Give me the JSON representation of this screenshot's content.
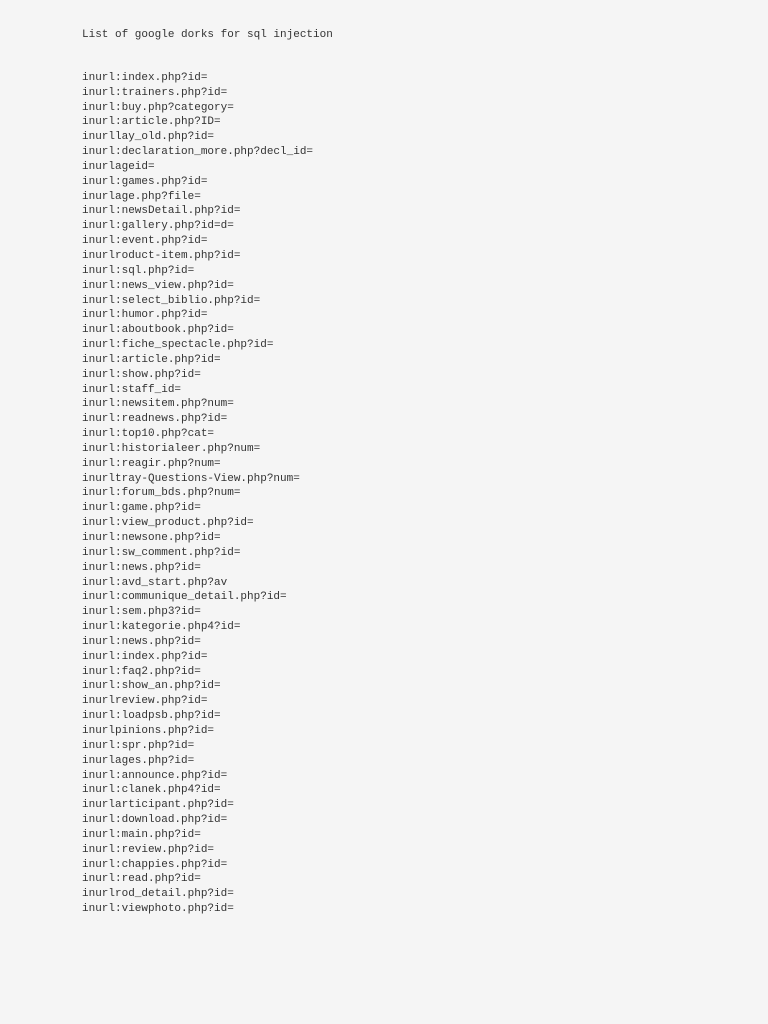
{
  "title": "List of google dorks for sql injection",
  "dorks": [
    "inurl:index.php?id=",
    "inurl:trainers.php?id=",
    "inurl:buy.php?category=",
    "inurl:article.php?ID=",
    "inurllay_old.php?id=",
    "inurl:declaration_more.php?decl_id=",
    "inurlageid=",
    "inurl:games.php?id=",
    "inurlage.php?file=",
    "inurl:newsDetail.php?id=",
    "inurl:gallery.php?id=d=",
    "inurl:event.php?id=",
    "inurlroduct-item.php?id=",
    "inurl:sql.php?id=",
    "inurl:news_view.php?id=",
    "inurl:select_biblio.php?id=",
    "inurl:humor.php?id=",
    "inurl:aboutbook.php?id=",
    "inurl:fiche_spectacle.php?id=",
    "inurl:article.php?id=",
    "inurl:show.php?id=",
    "inurl:staff_id=",
    "inurl:newsitem.php?num=",
    "inurl:readnews.php?id=",
    "inurl:top10.php?cat=",
    "inurl:historialeer.php?num=",
    "inurl:reagir.php?num=",
    "inurltray-Questions-View.php?num=",
    "inurl:forum_bds.php?num=",
    "inurl:game.php?id=",
    "inurl:view_product.php?id=",
    "inurl:newsone.php?id=",
    "inurl:sw_comment.php?id=",
    "inurl:news.php?id=",
    "inurl:avd_start.php?av",
    "inurl:communique_detail.php?id=",
    "inurl:sem.php3?id=",
    "inurl:kategorie.php4?id=",
    "inurl:news.php?id=",
    "inurl:index.php?id=",
    "inurl:faq2.php?id=",
    "inurl:show_an.php?id=",
    "inurlreview.php?id=",
    "inurl:loadpsb.php?id=",
    "inurlpinions.php?id=",
    "inurl:spr.php?id=",
    "inurlages.php?id=",
    "inurl:announce.php?id=",
    "inurl:clanek.php4?id=",
    "inurlarticipant.php?id=",
    "inurl:download.php?id=",
    "inurl:main.php?id=",
    "inurl:review.php?id=",
    "inurl:chappies.php?id=",
    "inurl:read.php?id=",
    "inurlrod_detail.php?id=",
    "inurl:viewphoto.php?id="
  ]
}
